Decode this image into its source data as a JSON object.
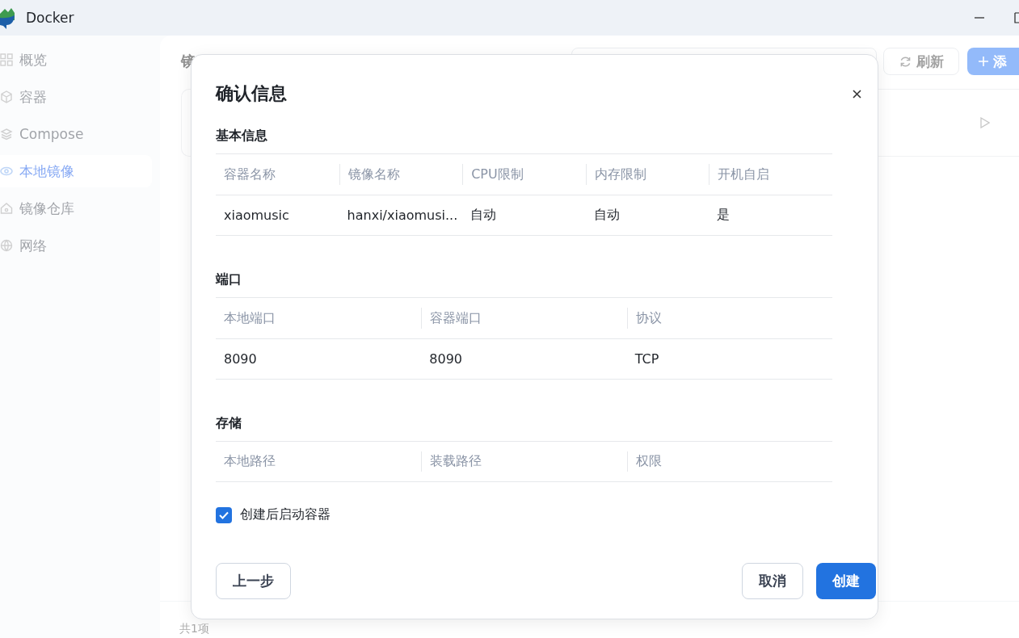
{
  "window": {
    "title": "Docker"
  },
  "sidebar": {
    "items": [
      {
        "label": "概览",
        "selected": false
      },
      {
        "label": "容器",
        "selected": false
      },
      {
        "label": "Compose",
        "selected": false
      },
      {
        "label": "本地镜像",
        "selected": true
      },
      {
        "label": "镜像仓库",
        "selected": false
      },
      {
        "label": "网络",
        "selected": false
      }
    ]
  },
  "page": {
    "title": "镜",
    "refresh_button": "刷新",
    "add_button": "添",
    "footer": "共1项"
  },
  "dialog": {
    "title": "确认信息",
    "sections": [
      {
        "title": "基本信息",
        "columns": [
          "容器名称",
          "镜像名称",
          "CPU限制",
          "内存限制",
          "开机自启"
        ],
        "rows": [
          [
            "xiaomusic",
            "hanxi/xiaomusi...",
            "自动",
            "自动",
            "是"
          ]
        ]
      },
      {
        "title": "端口",
        "columns": [
          "本地端口",
          "容器端口",
          "协议"
        ],
        "rows": [
          [
            "8090",
            "8090",
            "TCP"
          ]
        ]
      },
      {
        "title": "存储",
        "columns": [
          "本地路径",
          "装载路径",
          "权限"
        ]
      }
    ],
    "checkbox": {
      "label": "创建后启动容器",
      "checked": true
    },
    "back_button": "上一步",
    "cancel_button": "取消",
    "create_button": "创建"
  }
}
